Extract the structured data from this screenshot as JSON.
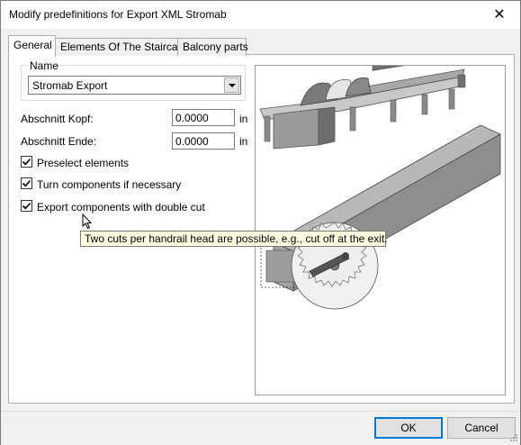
{
  "window": {
    "title": "Modify predefinitions for Export XML Stromab",
    "close_glyph": "✕"
  },
  "tabs": [
    {
      "label": "General",
      "active": true
    },
    {
      "label": "Elements Of The Staircase",
      "active": false
    },
    {
      "label": "Balcony parts",
      "active": false
    }
  ],
  "name_group": {
    "label": "Name",
    "selected": "Stromab Export"
  },
  "fields": [
    {
      "label": "Abschnitt Kopf:",
      "value": "0.0000",
      "unit": "in"
    },
    {
      "label": "Abschnitt Ende:",
      "value": "0.0000",
      "unit": "in"
    }
  ],
  "checkboxes": [
    {
      "label": "Preselect elements",
      "checked": true
    },
    {
      "label": "Turn components if necessary",
      "checked": true
    },
    {
      "label": "Export components with double cut",
      "checked": true
    }
  ],
  "tooltip": "Two cuts per handrail head are possible, e.g., cut off at the exit.",
  "buttons": {
    "ok": "OK",
    "cancel": "Cancel"
  }
}
